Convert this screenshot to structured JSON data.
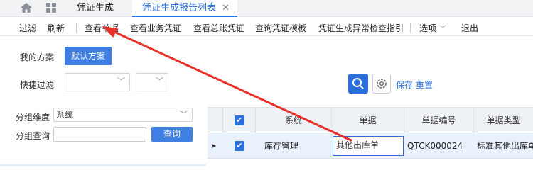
{
  "tabs": {
    "tab1": "凭证生成",
    "tab2": "凭证生成报告列表",
    "close": "✕"
  },
  "toolbar": {
    "filter": "过滤",
    "refresh": "刷新",
    "view_doc": "查看单据",
    "view_biz_voucher": "查看业务凭证",
    "view_gl_voucher": "查看总账凭证",
    "query_template": "查询凭证模板",
    "exception_guide": "凭证生成异常检查指引",
    "options": "选项",
    "exit": "退出"
  },
  "filter": {
    "my_scheme_label": "我的方案",
    "default_scheme": "默认方案",
    "quick_filter_label": "快捷过滤",
    "quick_filter_field_1": "",
    "quick_filter_field_2": "",
    "save": "保存",
    "reset": "重置"
  },
  "group": {
    "dimension_label": "分组维度",
    "dimension_value": "系统",
    "query_label": "分组查询",
    "query_value": "",
    "query_button": "查询"
  },
  "grid": {
    "columns": [
      "系统",
      "单据",
      "单据编号",
      "单据类型"
    ],
    "rows": [
      {
        "system": "库存管理",
        "doc": "其他出库单",
        "doc_no": "QTCK000024",
        "doc_type": "标准其他出库单"
      }
    ]
  },
  "annotation": {
    "color": "#e8312a"
  },
  "colors": {
    "accent": "#2a6fdb",
    "primary_button": "#3f7fe3"
  }
}
